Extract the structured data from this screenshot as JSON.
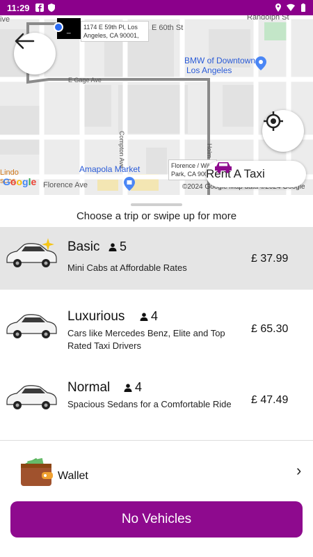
{
  "status_bar": {
    "time": "11:29",
    "left_icons": [
      "facebook-icon",
      "shield-icon"
    ],
    "right_icons": [
      "location-icon",
      "wifi-icon",
      "battery-icon"
    ]
  },
  "map": {
    "pickup_address": "1174 E 59th Pl, Los Angeles, CA 90001,",
    "marker_label": "_",
    "street_labels": {
      "e_60th": "E 60th St",
      "e_gage": "E Gage Ave",
      "randolph": "Randolph St",
      "compton": "Compton Ave",
      "florence": "Florence Ave",
      "holm": "Holm"
    },
    "poi": {
      "bmw_line1": "BMW of Downtown",
      "bmw_line2": "Los Angeles",
      "amapola": "Amapola Market",
      "lindo_1": "Lindo",
      "lindo_2": "scos",
      "ive": "ive"
    },
    "dest_card": "Florence / Wil Park, CA 900",
    "google_logo": "Google",
    "copyright": "©2024 Google   Map data ©2024 Google"
  },
  "buttons": {
    "rent_taxi": "Rent A Taxi",
    "no_vehicles": "No Vehicles"
  },
  "sheet": {
    "title": "Choose a trip or swipe up for more"
  },
  "trips": [
    {
      "name": "Basic",
      "seats": "5",
      "description": "Mini Cabs at Affordable Rates",
      "price": "£ 37.99",
      "selected": true
    },
    {
      "name": "Luxurious",
      "seats": "4",
      "description": "Cars like Mercedes Benz, Elite and Top Rated Taxi Drivers",
      "price": "£ 65.30",
      "selected": false
    },
    {
      "name": "Normal",
      "seats": "4",
      "description": "Spacious Sedans for a Comfortable Ride",
      "price": "£ 47.49",
      "selected": false
    }
  ],
  "wallet": {
    "label": "Wallet"
  },
  "colors": {
    "brand": "#8e0a8e",
    "status_bar": "#8b008b"
  }
}
